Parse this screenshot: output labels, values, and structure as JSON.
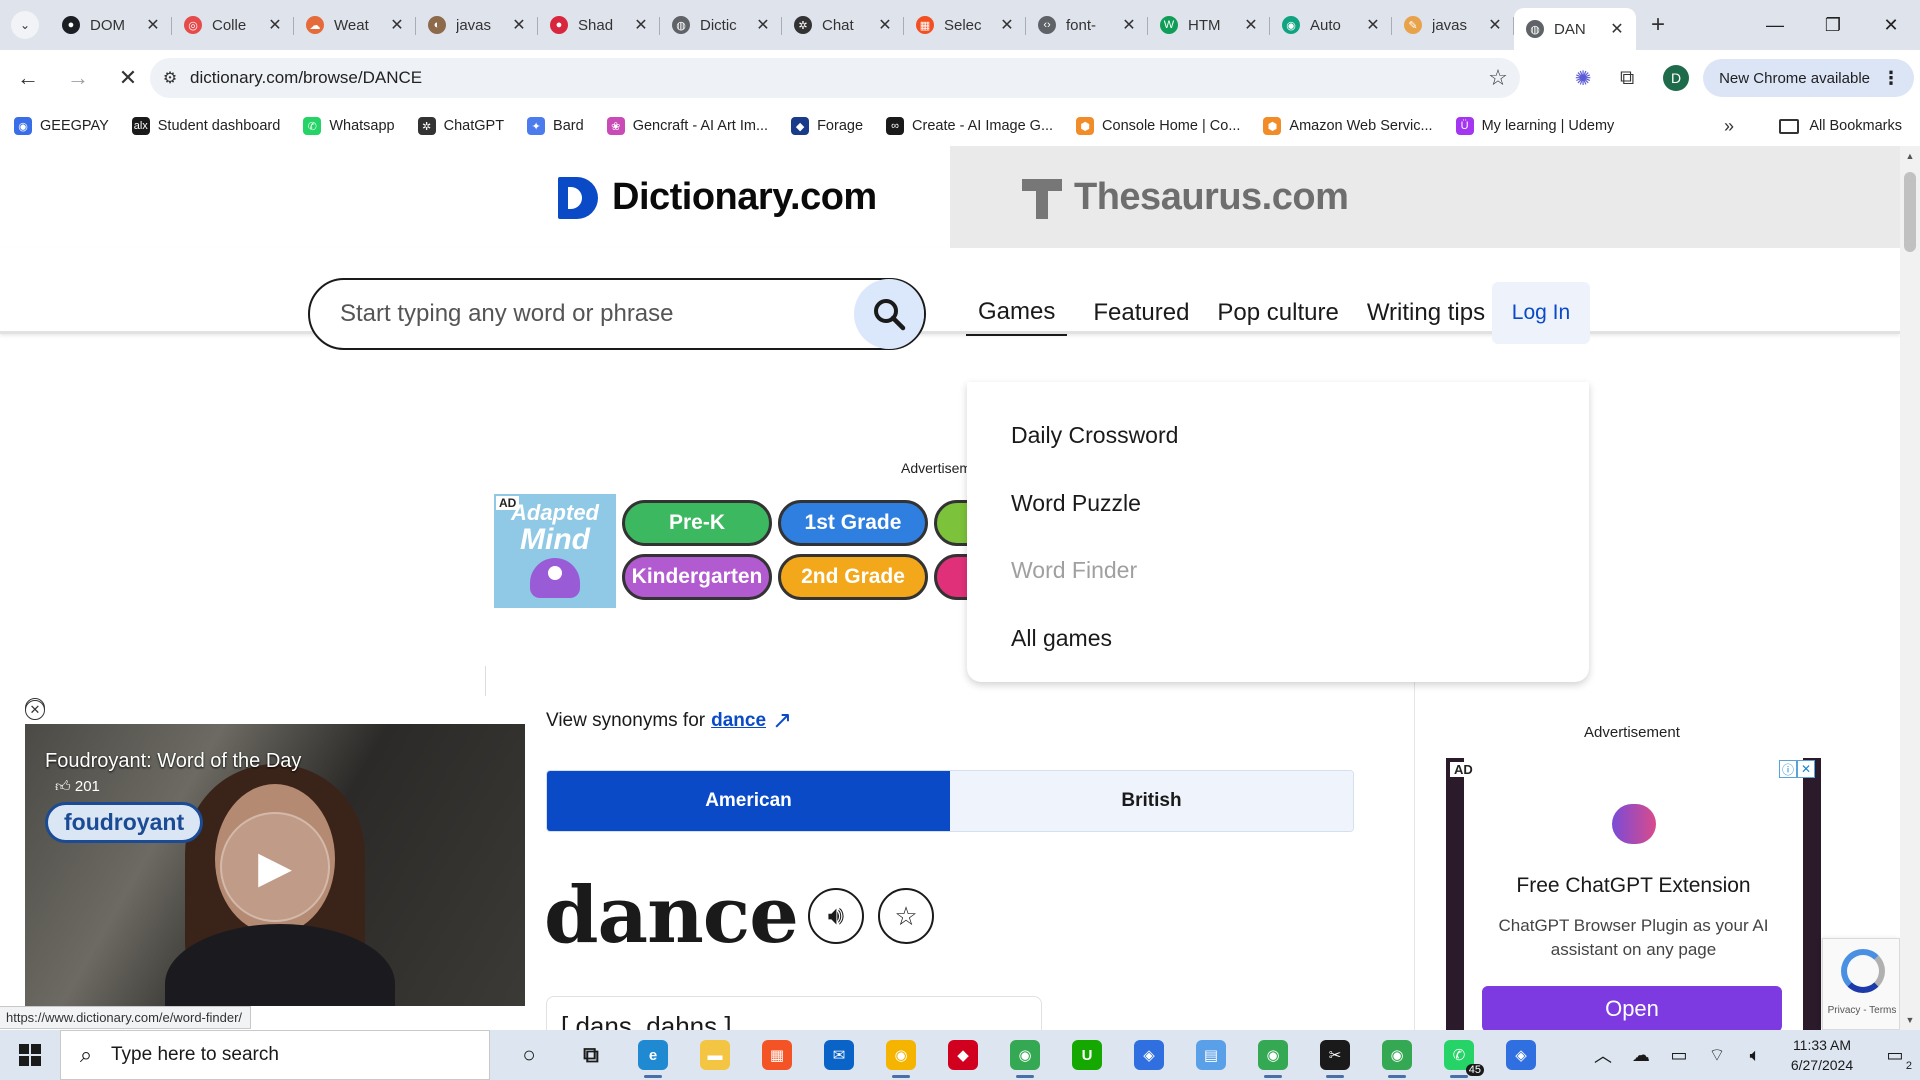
{
  "browser": {
    "tabs": [
      {
        "title": "DOM",
        "fav_color": "#1b1f23",
        "fav_glyph": "●"
      },
      {
        "title": "Colle",
        "fav_color": "#e54b4b",
        "fav_glyph": "◎"
      },
      {
        "title": "Weat",
        "fav_color": "#e66b3b",
        "fav_glyph": "☁"
      },
      {
        "title": "javas",
        "fav_color": "#8c6a4a",
        "fav_glyph": "◐"
      },
      {
        "title": "Shad",
        "fav_color": "#d7263d",
        "fav_glyph": "●"
      },
      {
        "title": "Dictic",
        "fav_color": "#5f6368",
        "fav_glyph": "◍"
      },
      {
        "title": "Chat",
        "fav_color": "#333333",
        "fav_glyph": "✲"
      },
      {
        "title": "Selec",
        "fav_color": "#f25022",
        "fav_glyph": "▦"
      },
      {
        "title": "font-",
        "fav_color": "#5f6368",
        "fav_glyph": "‹›"
      },
      {
        "title": "HTM",
        "fav_color": "#0f9d58",
        "fav_glyph": "W"
      },
      {
        "title": "Auto",
        "fav_color": "#10a37f",
        "fav_glyph": "◉"
      },
      {
        "title": "javas",
        "fav_color": "#e8a24a",
        "fav_glyph": "✎"
      },
      {
        "title": "DAN",
        "fav_color": "#5f6368",
        "fav_glyph": "◍"
      }
    ],
    "new_tab": "+",
    "window_controls": [
      "—",
      "❐",
      "✕"
    ],
    "url": "dictionary.com/browse/DANCE",
    "new_chrome": "New Chrome available",
    "profile_initial": "D",
    "bookmarks": [
      {
        "label": "GEEGPAY",
        "color": "#3a6ee8",
        "glyph": "◉"
      },
      {
        "label": "Student dashboard",
        "color": "#1a1a1a",
        "glyph": "alx"
      },
      {
        "label": "Whatsapp",
        "color": "#25d366",
        "glyph": "✆"
      },
      {
        "label": "ChatGPT",
        "color": "#333333",
        "glyph": "✲"
      },
      {
        "label": "Bard",
        "color": "#4b7bec",
        "glyph": "✦"
      },
      {
        "label": "Gencraft - AI Art Im...",
        "color": "#c94bb5",
        "glyph": "❀"
      },
      {
        "label": "Forage",
        "color": "#1a3a8a",
        "glyph": "◆"
      },
      {
        "label": "Create - AI Image G...",
        "color": "#1a1a1a",
        "glyph": "∞"
      },
      {
        "label": "Console Home | Co...",
        "color": "#f28c28",
        "glyph": "⬢"
      },
      {
        "label": "Amazon Web Servic...",
        "color": "#f28c28",
        "glyph": "⬢"
      },
      {
        "label": "My learning | Udemy",
        "color": "#a435f0",
        "glyph": "Ü"
      }
    ],
    "bookmarks_more": "»",
    "all_bookmarks": "All Bookmarks",
    "status_url": "https://www.dictionary.com/e/word-finder/"
  },
  "site": {
    "dict_name": "Dictionary.com",
    "thes_name": "Thesaurus.com",
    "search_placeholder": "Start typing any word or phrase",
    "nav": [
      "Games",
      "Featured",
      "Pop culture",
      "Writing tips"
    ],
    "login": "Log In",
    "games_menu": [
      "Daily Crossword",
      "Word Puzzle",
      "Word Finder",
      "All games"
    ]
  },
  "ad_top": {
    "label": "Advertisement",
    "tag": "AD",
    "brand_line1": "Adapted",
    "brand_line2": "Mind",
    "pills": [
      {
        "text": "Pre-K",
        "color": "#3cb860"
      },
      {
        "text": "1st Grade",
        "color": "#2f7fe0"
      },
      {
        "text": "",
        "color": "#7cc23a"
      },
      {
        "text": "Kindergarten",
        "color": "#b25ad0"
      },
      {
        "text": "2nd Grade",
        "color": "#f3a81b"
      },
      {
        "text": "",
        "color": "#e0307a"
      }
    ]
  },
  "video": {
    "title": "Foudroyant: Word of the Day",
    "likes": "201",
    "word_chip": "foudroyant"
  },
  "entry": {
    "synonyms_prefix": "View synonyms for",
    "synonyms_word": "dance",
    "dialects": [
      "American",
      "British"
    ],
    "headword": "dance",
    "pronunciation": "[ dans, dahns ]"
  },
  "ad_right": {
    "label": "Advertisement",
    "tag": "AD",
    "headline": "Free ChatGPT Extension",
    "body": "ChatGPT Browser Plugin as your AI assistant on any page",
    "cta": "Open",
    "recaptcha_text": "Privacy - Terms"
  },
  "taskbar": {
    "search_placeholder": "Type here to search",
    "time": "11:33 AM",
    "date": "6/27/2024",
    "whatsapp_badge": "45",
    "notif_count": "2",
    "apps": [
      {
        "name": "cortana",
        "color": "#1a1a1a",
        "glyph": "○"
      },
      {
        "name": "task-view",
        "color": "#1a1a1a",
        "glyph": "⧉"
      },
      {
        "name": "edge",
        "color": "#1f8ad2",
        "glyph": "e"
      },
      {
        "name": "file-explorer",
        "color": "#f4c542",
        "glyph": "▬"
      },
      {
        "name": "store",
        "color": "#f35325",
        "glyph": "▦"
      },
      {
        "name": "mail",
        "color": "#0a64c8",
        "glyph": "✉"
      },
      {
        "name": "chrome-orange",
        "color": "#f4b400",
        "glyph": "◉"
      },
      {
        "name": "brave",
        "color": "#d1001f",
        "glyph": "◆"
      },
      {
        "name": "chrome",
        "color": "#34a853",
        "glyph": "◉"
      },
      {
        "name": "upwork",
        "color": "#14a800",
        "glyph": "U"
      },
      {
        "name": "git",
        "color": "#2f6fe0",
        "glyph": "◈"
      },
      {
        "name": "notepad",
        "color": "#5aa0e8",
        "glyph": "▤"
      },
      {
        "name": "chrome-profile",
        "color": "#34a853",
        "glyph": "◉"
      },
      {
        "name": "capcut",
        "color": "#1a1a1a",
        "glyph": "✂"
      },
      {
        "name": "chrome-active",
        "color": "#34a853",
        "glyph": "◉"
      },
      {
        "name": "whatsapp",
        "color": "#25d366",
        "glyph": "✆"
      },
      {
        "name": "git-2",
        "color": "#2f6fe0",
        "glyph": "◈"
      }
    ]
  }
}
